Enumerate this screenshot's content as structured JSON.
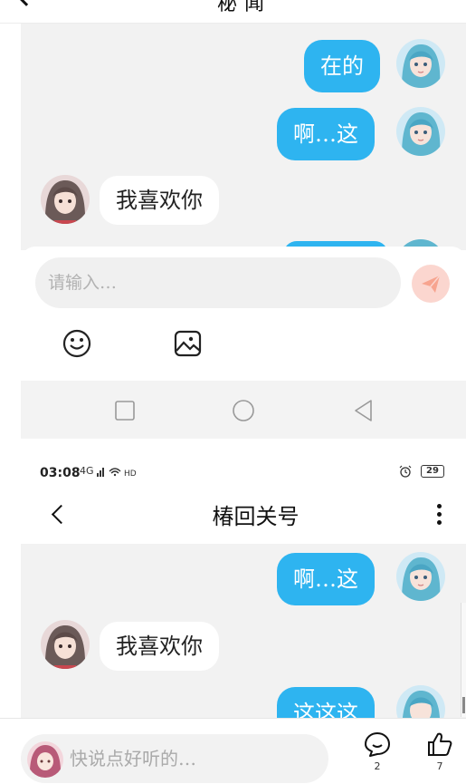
{
  "top_screen": {
    "title_fragment": "秘闻",
    "messages": [
      {
        "side": "me",
        "text": "在的"
      },
      {
        "side": "me",
        "text": "啊…这"
      },
      {
        "side": "them",
        "text": "我喜欢你"
      }
    ],
    "input": {
      "placeholder": "请输入…"
    }
  },
  "second_screen": {
    "status": {
      "time": "03:08",
      "network": "4G",
      "battery": "29"
    },
    "title": "椿回关号",
    "messages": [
      {
        "side": "me",
        "text": "啊…这"
      },
      {
        "side": "them",
        "text": "我喜欢你"
      },
      {
        "side": "me",
        "text": "这这这"
      }
    ]
  },
  "bottom_bar": {
    "comment_placeholder": "快说点好听的…",
    "comment_count": "2",
    "like_count": "7"
  },
  "colors": {
    "my_bubble": "#2eb4f0",
    "their_bubble": "#ffffff",
    "chat_bg": "#f2f2f2",
    "send_button": "#fbd6cf",
    "send_icon": "#f7a48f"
  }
}
